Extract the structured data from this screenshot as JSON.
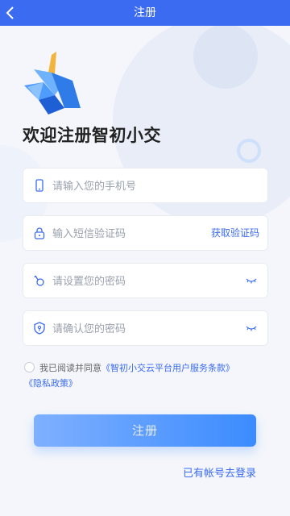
{
  "header": {
    "title": "注册",
    "back_icon": "back-arrow-icon"
  },
  "heading": "欢迎注册智初小交",
  "fields": {
    "phone": {
      "placeholder": "请输入您的手机号",
      "icon": "phone-icon"
    },
    "sms": {
      "placeholder": "输入短信验证码",
      "icon": "lock-icon",
      "action": "获取验证码"
    },
    "password": {
      "placeholder": "请设置您的密码",
      "icon": "key-icon",
      "toggle_icon": "eye-closed-icon"
    },
    "confirm": {
      "placeholder": "请确认您的密码",
      "icon": "shield-key-icon",
      "toggle_icon": "eye-closed-icon"
    }
  },
  "agreement": {
    "prefix": "我已阅读并同意",
    "terms_link": "《智初小交云平台用户服务条款》",
    "privacy_link": "《隐私政策》"
  },
  "submit_label": "注册",
  "login_link": "已有帐号去登录",
  "colors": {
    "primary": "#3b6bf0",
    "button_gradient_start": "#7fb0ff",
    "button_gradient_end": "#3b8bff"
  }
}
